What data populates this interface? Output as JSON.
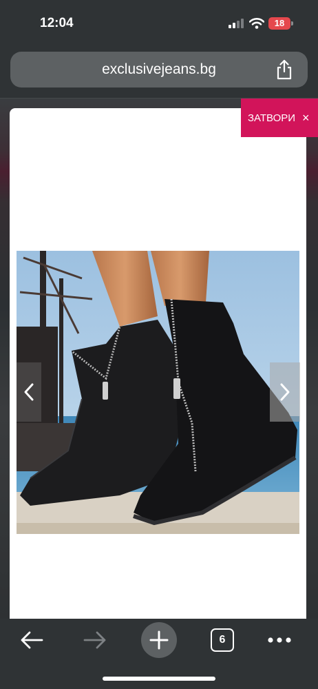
{
  "status_bar": {
    "time": "12:04",
    "battery": "18"
  },
  "browser": {
    "url": "exclusivejeans.bg",
    "tab_count": "6"
  },
  "overlay": {
    "close_label": "ЗАТВОРИ",
    "close_icon": "×"
  },
  "colors": {
    "accent": "#d2145a",
    "chrome": "#2f3335",
    "field": "#5d6163"
  }
}
